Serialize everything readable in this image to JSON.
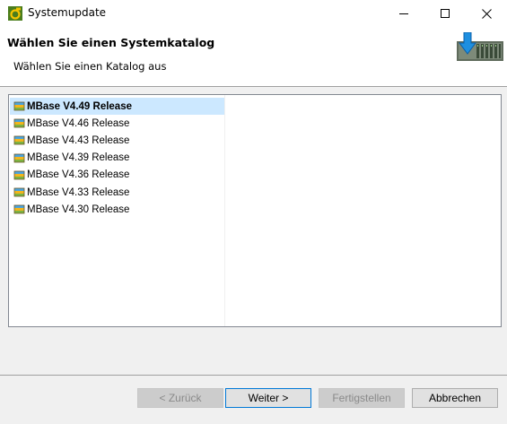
{
  "window": {
    "title": "Systemupdate",
    "icon": "app-icon",
    "controls": {
      "minimize": "minimize-icon",
      "maximize": "maximize-icon",
      "close": "close-icon"
    }
  },
  "header": {
    "title": "Wählen Sie einen Systemkatalog",
    "subtitle": "Wählen Sie einen Katalog aus",
    "image": "download-rack-icon"
  },
  "catalogs": [
    {
      "label": "MBase V4.49 Release",
      "selected": true
    },
    {
      "label": "MBase V4.46 Release",
      "selected": false
    },
    {
      "label": "MBase V4.43 Release",
      "selected": false
    },
    {
      "label": "MBase V4.39 Release",
      "selected": false
    },
    {
      "label": "MBase V4.36 Release",
      "selected": false
    },
    {
      "label": "MBase V4.33 Release",
      "selected": false
    },
    {
      "label": "MBase V4.30 Release",
      "selected": false
    }
  ],
  "buttons": {
    "back": {
      "label": "< Zurück",
      "enabled": false
    },
    "next": {
      "label": "Weiter >",
      "enabled": true
    },
    "finish": {
      "label": "Fertigstellen",
      "enabled": false
    },
    "cancel": {
      "label": "Abbrechen",
      "enabled": true
    }
  },
  "colors": {
    "selection": "#cce8ff",
    "accent": "#0078d7"
  }
}
